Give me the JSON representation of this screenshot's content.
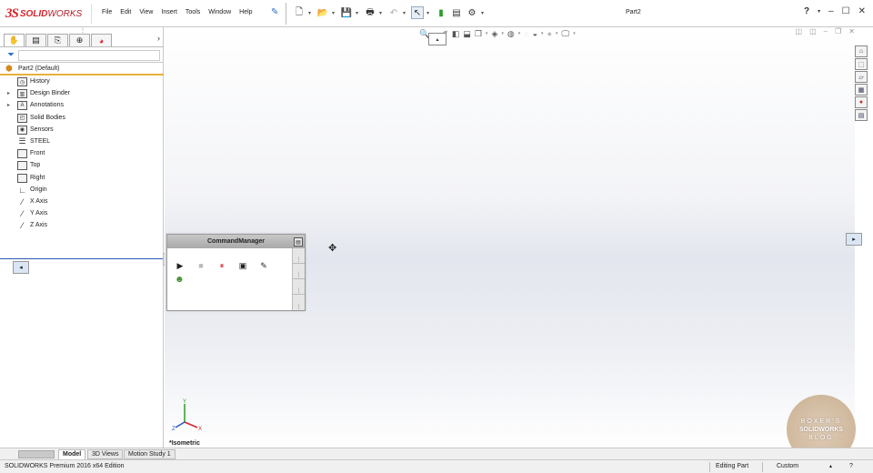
{
  "app": {
    "logo_ds": "3S",
    "logo_solid": "SOLID",
    "logo_works": "WORKS"
  },
  "menu": [
    "File",
    "Edit",
    "View",
    "Insert",
    "Tools",
    "Window",
    "Help"
  ],
  "document_title": "Part2",
  "panel": {
    "tabs": [
      "feature-manager",
      "property-manager",
      "configuration-manager",
      "dimxpert-manager",
      "display-manager"
    ],
    "filter_placeholder": "",
    "root": "Part2  (Default)",
    "tree": [
      {
        "label": "History",
        "icon": "history-icon",
        "expandable": false
      },
      {
        "label": "Design Binder",
        "icon": "design-binder-icon",
        "expandable": true
      },
      {
        "label": "Annotations",
        "icon": "annotations-icon",
        "expandable": true
      },
      {
        "label": "Solid Bodies",
        "icon": "solid-bodies-icon",
        "expandable": false
      },
      {
        "label": "Sensors",
        "icon": "sensors-icon",
        "expandable": false
      },
      {
        "label": "STEEL",
        "icon": "material-icon",
        "expandable": false
      },
      {
        "label": "Front",
        "icon": "plane-icon",
        "expandable": false
      },
      {
        "label": "Top",
        "icon": "plane-icon",
        "expandable": false
      },
      {
        "label": "Right",
        "icon": "plane-icon",
        "expandable": false
      },
      {
        "label": "Origin",
        "icon": "origin-icon",
        "expandable": false
      },
      {
        "label": "X Axis",
        "icon": "axis-icon",
        "expandable": false
      },
      {
        "label": "Y Axis",
        "icon": "axis-icon",
        "expandable": false
      },
      {
        "label": "Z Axis",
        "icon": "axis-icon",
        "expandable": false
      }
    ]
  },
  "cmdmgr": {
    "title": "CommandManager"
  },
  "viewport": {
    "view_label": "*Isometric"
  },
  "watermark": {
    "line1": "BOXER'S",
    "line2": "SOLIDWORKS",
    "line3": "BLOG"
  },
  "bottom_tabs": [
    "Model",
    "3D Views",
    "Motion Study 1"
  ],
  "status": {
    "product": "SOLIDWORKS Premium 2016 x64 Edition",
    "mode": "Editing Part",
    "units": "Custom"
  },
  "colors": {
    "brand": "#d5242b",
    "accent": "#2a72c9",
    "tree_root_underline": "#e8b03a"
  }
}
